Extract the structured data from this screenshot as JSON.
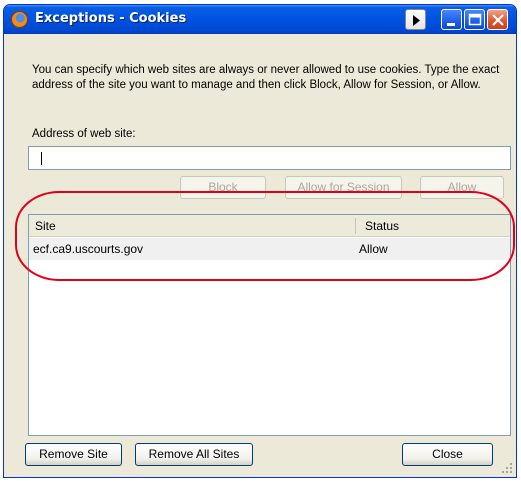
{
  "window": {
    "title": "Exceptions - Cookies"
  },
  "intro": {
    "text": "You can specify which web sites are always or never allowed to use cookies. Type the exact address of the site you want to manage and then click Block, Allow for Session, or Allow."
  },
  "address": {
    "label": "Address of web site:",
    "value": ""
  },
  "actions": {
    "block_label": "Block",
    "allow_session_label": "Allow for Session",
    "allow_label": "Allow"
  },
  "table": {
    "columns": [
      "Site",
      "Status"
    ],
    "rows": [
      {
        "site": "ecf.ca9.uscourts.gov",
        "status": "Allow"
      }
    ]
  },
  "footer": {
    "remove_site_label": "Remove Site",
    "remove_all_label": "Remove All Sites",
    "close_label": "Close"
  },
  "colors": {
    "titlebar": "#0055e5",
    "dialog_bg": "#ece9d8",
    "annotation": "#e0001a"
  }
}
